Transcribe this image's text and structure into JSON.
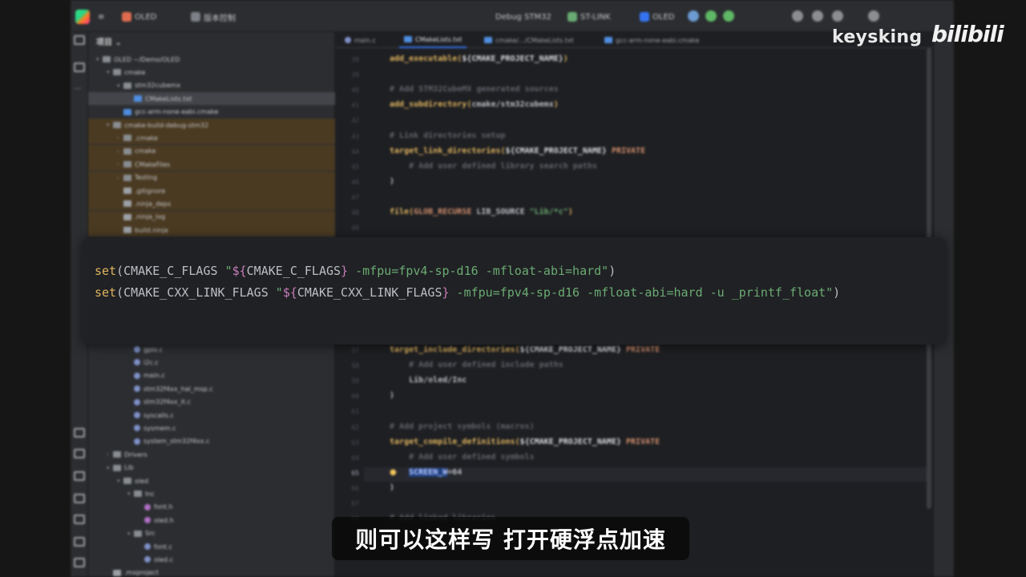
{
  "titlebar": {
    "project_name": "OLED",
    "vcs": "版本控制",
    "run_config": "Debug STM32",
    "debugger": "ST-LINK",
    "target": "OLED"
  },
  "project_panel": {
    "header": "项目",
    "items": [
      {
        "label": "OLED  ~/Demo/OLED",
        "indent": 0,
        "icon": "folder",
        "arrow": "▾"
      },
      {
        "label": "cmake",
        "indent": 1,
        "icon": "folder",
        "arrow": "▾"
      },
      {
        "label": "stm32cubemx",
        "indent": 2,
        "icon": "folder",
        "arrow": "▾"
      },
      {
        "label": "CMakeLists.txt",
        "indent": 3,
        "icon": "cm",
        "arrow": "",
        "selected": true
      },
      {
        "label": "gcc-arm-none-eabi.cmake",
        "indent": 2,
        "icon": "cm",
        "arrow": ""
      },
      {
        "label": "cmake-build-debug-stm32",
        "indent": 1,
        "icon": "folder",
        "arrow": "▾",
        "excluded": true
      },
      {
        "label": ".cmake",
        "indent": 2,
        "icon": "folder",
        "arrow": "›",
        "excluded": true
      },
      {
        "label": "cmake",
        "indent": 2,
        "icon": "folder",
        "arrow": "›",
        "excluded": true
      },
      {
        "label": "CMakeFiles",
        "indent": 2,
        "icon": "folder",
        "arrow": "›",
        "excluded": true
      },
      {
        "label": "Testing",
        "indent": 2,
        "icon": "folder",
        "arrow": "›",
        "excluded": true
      },
      {
        "label": ".gitignore",
        "indent": 2,
        "icon": "txt",
        "arrow": "",
        "excluded": true
      },
      {
        "label": ".ninja_deps",
        "indent": 2,
        "icon": "txt",
        "arrow": "",
        "excluded": true
      },
      {
        "label": ".ninja_log",
        "indent": 2,
        "icon": "txt",
        "arrow": "",
        "excluded": true
      },
      {
        "label": "build.ninja",
        "indent": 2,
        "icon": "txt",
        "arrow": "",
        "excluded": true
      }
    ],
    "items_lower": [
      {
        "label": "gpio.c",
        "indent": 3,
        "icon": "file",
        "arrow": ""
      },
      {
        "label": "i2c.c",
        "indent": 3,
        "icon": "file",
        "arrow": ""
      },
      {
        "label": "main.c",
        "indent": 3,
        "icon": "file",
        "arrow": ""
      },
      {
        "label": "stm32f4xx_hal_msp.c",
        "indent": 3,
        "icon": "file",
        "arrow": ""
      },
      {
        "label": "stm32f4xx_it.c",
        "indent": 3,
        "icon": "file",
        "arrow": ""
      },
      {
        "label": "syscalls.c",
        "indent": 3,
        "icon": "file",
        "arrow": ""
      },
      {
        "label": "sysmem.c",
        "indent": 3,
        "icon": "file",
        "arrow": ""
      },
      {
        "label": "system_stm32f4xx.c",
        "indent": 3,
        "icon": "file",
        "arrow": ""
      },
      {
        "label": "Drivers",
        "indent": 1,
        "icon": "folder",
        "arrow": "›"
      },
      {
        "label": "Lib",
        "indent": 1,
        "icon": "folder",
        "arrow": "▾"
      },
      {
        "label": "oled",
        "indent": 2,
        "icon": "folder",
        "arrow": "▾"
      },
      {
        "label": "Inc",
        "indent": 3,
        "icon": "folder",
        "arrow": "▾"
      },
      {
        "label": "font.h",
        "indent": 4,
        "icon": "h",
        "arrow": ""
      },
      {
        "label": "oled.h",
        "indent": 4,
        "icon": "h",
        "arrow": ""
      },
      {
        "label": "Src",
        "indent": 3,
        "icon": "folder",
        "arrow": "▾"
      },
      {
        "label": "font.c",
        "indent": 4,
        "icon": "file",
        "arrow": ""
      },
      {
        "label": "oled.c",
        "indent": 4,
        "icon": "file",
        "arrow": ""
      },
      {
        "label": ".mxproject",
        "indent": 1,
        "icon": "txt",
        "arrow": ""
      }
    ]
  },
  "tabs": [
    {
      "label": "main.c",
      "icon": "file",
      "active": false
    },
    {
      "label": "CMakeLists.txt",
      "icon": "cm",
      "active": true
    },
    {
      "label": "cmake/.../CMakeLists.txt",
      "icon": "cm",
      "active": false
    },
    {
      "label": "gcc-arm-none-eabi.cmake",
      "icon": "cm",
      "active": false
    }
  ],
  "editor": {
    "top_lines": [
      {
        "num": "38",
        "segments": [
          {
            "t": "add_executable(",
            "c": "fn"
          },
          {
            "t": "${CMAKE_PROJECT_NAME}",
            "c": "var"
          },
          {
            "t": ")",
            "c": "fn"
          }
        ]
      },
      {
        "num": "39",
        "segments": []
      },
      {
        "num": "40",
        "segments": [
          {
            "t": "# Add STM32CubeMX generated sources",
            "c": "cmt"
          }
        ]
      },
      {
        "num": "41",
        "segments": [
          {
            "t": "add_subdirectory(",
            "c": "fn"
          },
          {
            "t": "cmake/stm32cubemx",
            "c": "plain"
          },
          {
            "t": ")",
            "c": "fn"
          }
        ]
      },
      {
        "num": "42",
        "segments": []
      },
      {
        "num": "43",
        "segments": [
          {
            "t": "# Link directories setup",
            "c": "cmt"
          }
        ]
      },
      {
        "num": "44",
        "segments": [
          {
            "t": "target_link_directories(",
            "c": "fn"
          },
          {
            "t": "${CMAKE_PROJECT_NAME} ",
            "c": "var"
          },
          {
            "t": "PRIVATE",
            "c": "kw"
          }
        ]
      },
      {
        "num": "45",
        "segments": [
          {
            "t": "    # Add user defined library search paths",
            "c": "cmt"
          }
        ]
      },
      {
        "num": "46",
        "segments": [
          {
            "t": ")",
            "c": "plain"
          }
        ]
      },
      {
        "num": "47",
        "segments": []
      },
      {
        "num": "48",
        "segments": [
          {
            "t": "file(",
            "c": "fn"
          },
          {
            "t": "GLOB_RECURSE ",
            "c": "kw"
          },
          {
            "t": "LIB_SOURCE ",
            "c": "plain"
          },
          {
            "t": "\"Lib/*c\"",
            "c": "str"
          },
          {
            "t": ")",
            "c": "fn"
          }
        ]
      },
      {
        "num": "49",
        "segments": []
      }
    ],
    "bottom_lines": [
      {
        "num": "57",
        "segments": [
          {
            "t": "target_include_directories(",
            "c": "fn"
          },
          {
            "t": "${CMAKE_PROJECT_NAME} ",
            "c": "var"
          },
          {
            "t": "PRIVATE",
            "c": "kw"
          }
        ]
      },
      {
        "num": "58",
        "segments": [
          {
            "t": "    # Add user defined include paths",
            "c": "cmt"
          }
        ]
      },
      {
        "num": "59",
        "segments": [
          {
            "t": "    Lib/oled/Inc",
            "c": "plain"
          }
        ]
      },
      {
        "num": "60",
        "segments": [
          {
            "t": ")",
            "c": "plain"
          }
        ]
      },
      {
        "num": "61",
        "segments": []
      },
      {
        "num": "62",
        "segments": [
          {
            "t": "# Add project symbols (macros)",
            "c": "cmt"
          }
        ]
      },
      {
        "num": "63",
        "segments": [
          {
            "t": "target_compile_definitions(",
            "c": "fn"
          },
          {
            "t": "${CMAKE_PROJECT_NAME} ",
            "c": "var"
          },
          {
            "t": "PRIVATE",
            "c": "kw"
          }
        ]
      },
      {
        "num": "64",
        "segments": [
          {
            "t": "    # Add user defined symbols",
            "c": "cmt"
          }
        ]
      },
      {
        "num": "65",
        "segments": [
          {
            "t": "    ",
            "c": "plain"
          },
          {
            "t": "SCREEN_W",
            "c": "sel"
          },
          {
            "t": "=64",
            "c": "plain"
          }
        ]
      },
      {
        "num": "66",
        "segments": [
          {
            "t": ")",
            "c": "plain"
          }
        ]
      },
      {
        "num": "67",
        "segments": []
      },
      {
        "num": "68",
        "segments": [
          {
            "t": "# Add linked libraries",
            "c": "cmt"
          }
        ]
      }
    ]
  },
  "overlay_code": {
    "line1": [
      {
        "t": "set",
        "c": "ov-fn"
      },
      {
        "t": "(CMAKE_C_FLAGS ",
        "c": "plain"
      },
      {
        "t": "\"",
        "c": "ov-str"
      },
      {
        "t": "${",
        "c": "ov-brace"
      },
      {
        "t": "CMAKE_C_FLAGS",
        "c": "plain"
      },
      {
        "t": "}",
        "c": "ov-brace"
      },
      {
        "t": " -mfpu=fpv4-sp-d16 -mfloat-abi=hard\"",
        "c": "ov-str"
      },
      {
        "t": ")",
        "c": "plain"
      }
    ],
    "line2": [
      {
        "t": "set",
        "c": "ov-fn"
      },
      {
        "t": "(CMAKE_CXX_LINK_FLAGS ",
        "c": "plain"
      },
      {
        "t": "\"",
        "c": "ov-str"
      },
      {
        "t": "${",
        "c": "ov-brace"
      },
      {
        "t": "CMAKE_CXX_LINK_FLAGS",
        "c": "plain"
      },
      {
        "t": "}",
        "c": "ov-brace"
      },
      {
        "t": " -mfpu=fpv4-sp-d16 -mfloat-abi=hard -u _printf_float\"",
        "c": "ov-str"
      },
      {
        "t": ")",
        "c": "plain"
      }
    ]
  },
  "branding": {
    "channel": "keysking",
    "platform": "bilibili"
  },
  "subtitle": "则可以这样写 打开硬浮点加速",
  "colors": {
    "editor_bg": "#1e1f22",
    "panel_bg": "#2b2d30",
    "function": "#e0b45f",
    "string": "#6aab73",
    "comment": "#5f636a",
    "keyword": "#cf8e6d",
    "selection": "#214283"
  }
}
